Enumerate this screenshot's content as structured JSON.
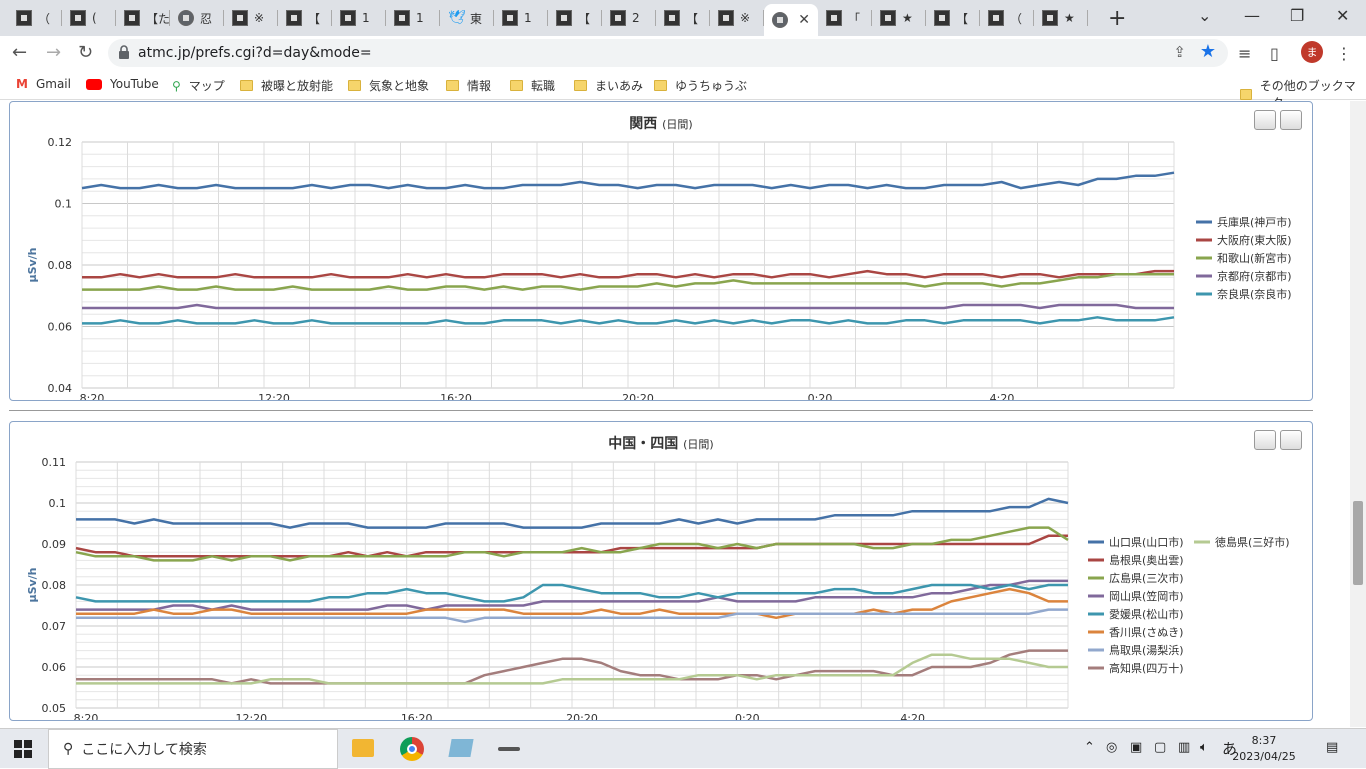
{
  "tabs": [
    {
      "title": "（",
      "icon": "site-icon"
    },
    {
      "title": "(",
      "icon": "site-icon"
    },
    {
      "title": "【た",
      "icon": "site-icon"
    },
    {
      "title": "忍",
      "icon": "globe-icon"
    },
    {
      "title": "※",
      "icon": "site-icon"
    },
    {
      "title": "【",
      "icon": "site-icon"
    },
    {
      "title": "1",
      "icon": "site-icon"
    },
    {
      "title": "1",
      "icon": "site-icon"
    },
    {
      "title": "東",
      "icon": "twitter-icon"
    },
    {
      "title": "1",
      "icon": "site-icon"
    },
    {
      "title": "【",
      "icon": "site-icon"
    },
    {
      "title": "2",
      "icon": "site-icon"
    },
    {
      "title": "【",
      "icon": "site-icon"
    },
    {
      "title": "※",
      "icon": "site-icon"
    },
    {
      "title": "",
      "icon": "globe-icon",
      "active": true
    },
    {
      "title": "「",
      "icon": "site-icon"
    },
    {
      "title": "★",
      "icon": "site-icon"
    },
    {
      "title": "【",
      "icon": "site-icon"
    },
    {
      "title": "（",
      "icon": "site-icon"
    },
    {
      "title": "★",
      "icon": "site-icon"
    }
  ],
  "address": {
    "url": "atmc.jp/prefs.cgi?d=day&mode="
  },
  "profile_initial": "ま",
  "bookmarks": [
    {
      "label": "Gmail",
      "icon": "gmail-icon"
    },
    {
      "label": "YouTube",
      "icon": "youtube-icon"
    },
    {
      "label": "マップ",
      "icon": "maps-icon"
    },
    {
      "label": "被曝と放射能",
      "icon": "folder-icon"
    },
    {
      "label": "気象と地象",
      "icon": "folder-icon"
    },
    {
      "label": "情報",
      "icon": "folder-icon"
    },
    {
      "label": "転職",
      "icon": "folder-icon"
    },
    {
      "label": "まいあみ",
      "icon": "folder-icon"
    },
    {
      "label": "ゆうちゅうぶ",
      "icon": "folder-icon"
    }
  ],
  "other_bookmarks": "その他のブックマーク",
  "chart_data": [
    {
      "type": "line",
      "title": "関西",
      "subtitle": "(日間)",
      "ylabel": "μSv/h",
      "ylim": [
        0.04,
        0.12
      ],
      "yticks": [
        "0.04",
        "0.06",
        "0.08",
        "0.1",
        "0.12"
      ],
      "xticks": [
        "8:20",
        "12:20",
        "16:20",
        "20:20",
        "0:20",
        "4:20"
      ],
      "legend_position": "right",
      "grid": true,
      "series": [
        {
          "name": "兵庫県(神戸市)",
          "color": "#4572a7",
          "values": [
            0.105,
            0.106,
            0.105,
            0.105,
            0.106,
            0.105,
            0.105,
            0.106,
            0.105,
            0.105,
            0.105,
            0.105,
            0.106,
            0.105,
            0.106,
            0.106,
            0.105,
            0.106,
            0.105,
            0.105,
            0.106,
            0.105,
            0.105,
            0.106,
            0.106,
            0.106,
            0.107,
            0.106,
            0.106,
            0.105,
            0.106,
            0.106,
            0.105,
            0.106,
            0.106,
            0.106,
            0.105,
            0.106,
            0.105,
            0.106,
            0.106,
            0.105,
            0.106,
            0.105,
            0.105,
            0.106,
            0.106,
            0.106,
            0.107,
            0.105,
            0.106,
            0.107,
            0.106,
            0.108,
            0.108,
            0.109,
            0.109,
            0.11
          ]
        },
        {
          "name": "大阪府(東大阪)",
          "color": "#aa4643",
          "values": [
            0.076,
            0.076,
            0.077,
            0.076,
            0.077,
            0.076,
            0.076,
            0.076,
            0.077,
            0.076,
            0.076,
            0.076,
            0.076,
            0.077,
            0.076,
            0.076,
            0.076,
            0.077,
            0.076,
            0.077,
            0.076,
            0.076,
            0.077,
            0.077,
            0.077,
            0.076,
            0.077,
            0.076,
            0.076,
            0.077,
            0.077,
            0.076,
            0.077,
            0.076,
            0.077,
            0.077,
            0.076,
            0.077,
            0.077,
            0.076,
            0.077,
            0.078,
            0.077,
            0.077,
            0.076,
            0.077,
            0.077,
            0.077,
            0.076,
            0.077,
            0.077,
            0.076,
            0.077,
            0.077,
            0.077,
            0.077,
            0.078,
            0.078
          ]
        },
        {
          "name": "和歌山(新宮市)",
          "color": "#89a54e",
          "values": [
            0.072,
            0.072,
            0.072,
            0.072,
            0.073,
            0.072,
            0.072,
            0.073,
            0.072,
            0.072,
            0.072,
            0.073,
            0.072,
            0.072,
            0.072,
            0.072,
            0.073,
            0.072,
            0.072,
            0.073,
            0.073,
            0.072,
            0.073,
            0.072,
            0.073,
            0.073,
            0.072,
            0.073,
            0.073,
            0.073,
            0.074,
            0.073,
            0.074,
            0.074,
            0.075,
            0.074,
            0.074,
            0.074,
            0.074,
            0.074,
            0.074,
            0.074,
            0.074,
            0.074,
            0.073,
            0.074,
            0.074,
            0.074,
            0.073,
            0.074,
            0.074,
            0.075,
            0.076,
            0.076,
            0.077,
            0.077,
            0.077,
            0.077
          ]
        },
        {
          "name": "京都府(京都市)",
          "color": "#80699b",
          "values": [
            0.066,
            0.066,
            0.066,
            0.066,
            0.066,
            0.066,
            0.067,
            0.066,
            0.066,
            0.066,
            0.066,
            0.066,
            0.066,
            0.066,
            0.066,
            0.066,
            0.066,
            0.066,
            0.066,
            0.066,
            0.066,
            0.066,
            0.066,
            0.066,
            0.066,
            0.066,
            0.066,
            0.066,
            0.066,
            0.066,
            0.066,
            0.066,
            0.066,
            0.066,
            0.066,
            0.066,
            0.066,
            0.066,
            0.066,
            0.066,
            0.066,
            0.066,
            0.066,
            0.066,
            0.066,
            0.066,
            0.067,
            0.067,
            0.067,
            0.067,
            0.066,
            0.067,
            0.067,
            0.067,
            0.067,
            0.066,
            0.066,
            0.066
          ]
        },
        {
          "name": "奈良県(奈良市)",
          "color": "#3d96ae",
          "values": [
            0.061,
            0.061,
            0.062,
            0.061,
            0.061,
            0.062,
            0.061,
            0.061,
            0.061,
            0.062,
            0.061,
            0.061,
            0.062,
            0.061,
            0.061,
            0.061,
            0.061,
            0.061,
            0.061,
            0.062,
            0.061,
            0.061,
            0.062,
            0.062,
            0.062,
            0.061,
            0.062,
            0.061,
            0.062,
            0.061,
            0.061,
            0.062,
            0.061,
            0.062,
            0.061,
            0.062,
            0.061,
            0.062,
            0.062,
            0.061,
            0.062,
            0.061,
            0.061,
            0.062,
            0.062,
            0.061,
            0.062,
            0.062,
            0.062,
            0.062,
            0.061,
            0.062,
            0.062,
            0.063,
            0.062,
            0.062,
            0.062,
            0.063
          ]
        }
      ]
    },
    {
      "type": "line",
      "title": "中国・四国",
      "subtitle": "(日間)",
      "ylabel": "μSv/h",
      "ylim": [
        0.05,
        0.11
      ],
      "yticks": [
        "0.05",
        "0.06",
        "0.07",
        "0.08",
        "0.09",
        "0.1",
        "0.11"
      ],
      "xticks": [
        "8:20",
        "12:20",
        "16:20",
        "20:20",
        "0:20",
        "4:20"
      ],
      "legend_position": "right",
      "grid": true,
      "series": [
        {
          "name": "山口県(山口市)",
          "color": "#4572a7",
          "values": [
            0.096,
            0.096,
            0.096,
            0.095,
            0.096,
            0.095,
            0.095,
            0.095,
            0.095,
            0.095,
            0.095,
            0.094,
            0.095,
            0.095,
            0.095,
            0.094,
            0.094,
            0.094,
            0.094,
            0.095,
            0.095,
            0.095,
            0.095,
            0.094,
            0.094,
            0.094,
            0.094,
            0.095,
            0.095,
            0.095,
            0.095,
            0.096,
            0.095,
            0.096,
            0.095,
            0.096,
            0.096,
            0.096,
            0.096,
            0.097,
            0.097,
            0.097,
            0.097,
            0.098,
            0.098,
            0.098,
            0.098,
            0.098,
            0.099,
            0.099,
            0.101,
            0.1
          ]
        },
        {
          "name": "島根県(奥出雲)",
          "color": "#aa4643",
          "values": [
            0.089,
            0.088,
            0.088,
            0.087,
            0.087,
            0.087,
            0.087,
            0.087,
            0.087,
            0.087,
            0.087,
            0.087,
            0.087,
            0.087,
            0.088,
            0.087,
            0.088,
            0.087,
            0.088,
            0.088,
            0.088,
            0.088,
            0.088,
            0.088,
            0.088,
            0.088,
            0.088,
            0.088,
            0.089,
            0.089,
            0.089,
            0.089,
            0.089,
            0.089,
            0.089,
            0.089,
            0.09,
            0.09,
            0.09,
            0.09,
            0.09,
            0.09,
            0.09,
            0.09,
            0.09,
            0.09,
            0.09,
            0.09,
            0.09,
            0.09,
            0.092,
            0.092
          ]
        },
        {
          "name": "広島県(三次市)",
          "color": "#89a54e",
          "values": [
            0.088,
            0.087,
            0.087,
            0.087,
            0.086,
            0.086,
            0.086,
            0.087,
            0.086,
            0.087,
            0.087,
            0.086,
            0.087,
            0.087,
            0.087,
            0.087,
            0.087,
            0.087,
            0.087,
            0.087,
            0.088,
            0.088,
            0.087,
            0.088,
            0.088,
            0.088,
            0.089,
            0.088,
            0.088,
            0.089,
            0.09,
            0.09,
            0.09,
            0.089,
            0.09,
            0.089,
            0.09,
            0.09,
            0.09,
            0.09,
            0.09,
            0.089,
            0.089,
            0.09,
            0.09,
            0.091,
            0.091,
            0.092,
            0.093,
            0.094,
            0.094,
            0.091
          ]
        },
        {
          "name": "岡山県(笠岡市)",
          "color": "#80699b",
          "values": [
            0.074,
            0.074,
            0.074,
            0.074,
            0.074,
            0.075,
            0.075,
            0.074,
            0.075,
            0.074,
            0.074,
            0.074,
            0.074,
            0.074,
            0.074,
            0.074,
            0.075,
            0.075,
            0.074,
            0.075,
            0.075,
            0.075,
            0.075,
            0.075,
            0.076,
            0.076,
            0.076,
            0.076,
            0.076,
            0.076,
            0.076,
            0.076,
            0.076,
            0.077,
            0.076,
            0.076,
            0.076,
            0.076,
            0.077,
            0.077,
            0.077,
            0.077,
            0.077,
            0.077,
            0.078,
            0.078,
            0.079,
            0.08,
            0.08,
            0.081,
            0.081,
            0.081
          ]
        },
        {
          "name": "愛媛県(松山市)",
          "color": "#3d96ae",
          "values": [
            0.077,
            0.076,
            0.076,
            0.076,
            0.076,
            0.076,
            0.076,
            0.076,
            0.076,
            0.076,
            0.076,
            0.076,
            0.076,
            0.077,
            0.077,
            0.078,
            0.078,
            0.079,
            0.078,
            0.078,
            0.077,
            0.076,
            0.076,
            0.077,
            0.08,
            0.08,
            0.079,
            0.078,
            0.078,
            0.078,
            0.077,
            0.077,
            0.078,
            0.077,
            0.078,
            0.078,
            0.078,
            0.078,
            0.078,
            0.079,
            0.079,
            0.078,
            0.078,
            0.079,
            0.08,
            0.08,
            0.08,
            0.079,
            0.08,
            0.079,
            0.08,
            0.08
          ]
        },
        {
          "name": "香川県(さぬき)",
          "color": "#db843d",
          "values": [
            0.073,
            0.073,
            0.073,
            0.073,
            0.074,
            0.073,
            0.073,
            0.074,
            0.074,
            0.073,
            0.073,
            0.073,
            0.073,
            0.073,
            0.073,
            0.073,
            0.073,
            0.073,
            0.074,
            0.074,
            0.074,
            0.074,
            0.074,
            0.073,
            0.073,
            0.073,
            0.073,
            0.074,
            0.073,
            0.073,
            0.074,
            0.073,
            0.073,
            0.073,
            0.073,
            0.073,
            0.072,
            0.073,
            0.073,
            0.073,
            0.073,
            0.074,
            0.073,
            0.074,
            0.074,
            0.076,
            0.077,
            0.078,
            0.079,
            0.078,
            0.076,
            0.076
          ]
        },
        {
          "name": "鳥取県(湯梨浜)",
          "color": "#92a8cd",
          "values": [
            0.072,
            0.072,
            0.072,
            0.072,
            0.072,
            0.072,
            0.072,
            0.072,
            0.072,
            0.072,
            0.072,
            0.072,
            0.072,
            0.072,
            0.072,
            0.072,
            0.072,
            0.072,
            0.072,
            0.072,
            0.071,
            0.072,
            0.072,
            0.072,
            0.072,
            0.072,
            0.072,
            0.072,
            0.072,
            0.072,
            0.072,
            0.072,
            0.072,
            0.072,
            0.073,
            0.073,
            0.073,
            0.073,
            0.073,
            0.073,
            0.073,
            0.073,
            0.073,
            0.073,
            0.073,
            0.073,
            0.073,
            0.073,
            0.073,
            0.073,
            0.074,
            0.074
          ]
        },
        {
          "name": "高知県(四万十)",
          "color": "#a47d7c",
          "values": [
            0.057,
            0.057,
            0.057,
            0.057,
            0.057,
            0.057,
            0.057,
            0.057,
            0.056,
            0.057,
            0.056,
            0.056,
            0.056,
            0.056,
            0.056,
            0.056,
            0.056,
            0.056,
            0.056,
            0.056,
            0.056,
            0.058,
            0.059,
            0.06,
            0.061,
            0.062,
            0.062,
            0.061,
            0.059,
            0.058,
            0.058,
            0.057,
            0.057,
            0.057,
            0.058,
            0.058,
            0.057,
            0.058,
            0.059,
            0.059,
            0.059,
            0.059,
            0.058,
            0.058,
            0.06,
            0.06,
            0.06,
            0.061,
            0.063,
            0.064,
            0.064,
            0.064
          ]
        },
        {
          "name": "徳島県(三好市)",
          "color": "#b5ca92",
          "values": [
            0.056,
            0.056,
            0.056,
            0.056,
            0.056,
            0.056,
            0.056,
            0.056,
            0.056,
            0.056,
            0.057,
            0.057,
            0.057,
            0.056,
            0.056,
            0.056,
            0.056,
            0.056,
            0.056,
            0.056,
            0.056,
            0.056,
            0.056,
            0.056,
            0.056,
            0.057,
            0.057,
            0.057,
            0.057,
            0.057,
            0.057,
            0.057,
            0.058,
            0.058,
            0.058,
            0.057,
            0.058,
            0.058,
            0.058,
            0.058,
            0.058,
            0.058,
            0.058,
            0.061,
            0.063,
            0.063,
            0.062,
            0.062,
            0.062,
            0.061,
            0.06,
            0.06
          ]
        }
      ]
    }
  ],
  "taskbar": {
    "search_placeholder": "ここに入力して検索",
    "ime": "あ",
    "time": "8:37",
    "date": "2023/04/25"
  }
}
